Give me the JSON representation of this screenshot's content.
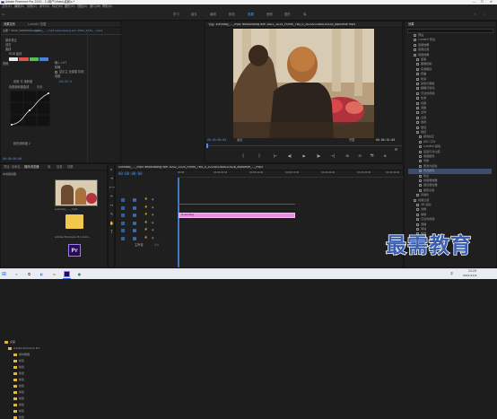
{
  "window": {
    "title": "Adobe Premiere Pro 2020 - C:\\用户\\Video\\桌面\\s *",
    "min": "—",
    "max": "☐",
    "close": "✕"
  },
  "menu": [
    "文件(F)",
    "编辑(E)",
    "剪辑(C)",
    "序列(S)",
    "标记(M)",
    "图形(G)",
    "视图(V)",
    "窗口(W)",
    "帮助(H)"
  ],
  "workspaces": [
    "学习",
    "组件",
    "编辑",
    "颜色",
    "效果",
    "音频",
    "图形",
    "库"
  ],
  "effect_controls": {
    "tabs": [
      "效果控件",
      "Lumetri 范围"
    ],
    "source_clip": "主要 * 2020_9000000...mp4",
    "sequence_clip": "sunnday_..._mp4 lessouwang wm 2002_2024_...mp4",
    "sections": [
      "基本校正",
      "创意",
      "曲线",
      "RGB 曲线",
      "色相饱和度曲线"
    ],
    "rows": {
      "fx": "视频",
      "lut": "输入 LUT",
      "sub": "精确",
      "check_label": "显示主 全部模 特效",
      "bg": "强度",
      "hue_row": "色相 与 饱和度",
      "hue_val": "100.00 %",
      "hue_sel": "色相",
      "bottom": "颜色饱和度 2"
    },
    "timecode": "00:00:00:00"
  },
  "program": {
    "tab": "节目: sunnday_..._mp4 lessouwang wm 2002_2024_Hunts_760_0_20200326002042p_aqd0e0e mp4",
    "timecode_left": "00:00:00:00",
    "fit": "适合",
    "quality": "完整",
    "timecode_right": "00:00:10:00",
    "controls": [
      "{",
      "}",
      "|←",
      "◀|",
      "▶",
      "|▶",
      "→|",
      "⊞",
      "⊟",
      "📷",
      "⊕"
    ]
  },
  "project": {
    "tabs": [
      "项目: 未命名",
      "媒体浏览器",
      "库",
      "信息",
      "效果"
    ],
    "root": "本地驱动器",
    "tree": [
      "桌面",
      "Adobe Premiere Pro",
      "素材教程",
      "新建",
      "新建",
      "新建",
      "新建",
      "新建",
      "新建",
      "新建",
      "新建",
      "新建",
      "新建"
    ],
    "thumb_label": "sunnday_..._mp4",
    "thumb2_label": "Adobe Premiere Pro Auto..."
  },
  "timeline": {
    "tab": "sunnday_..._mp4 lessouwang wm 2002_2024_Hunts_760_0_20200326002042p_aqd0e0e_..._mp4",
    "timecode": "00:00:00:00",
    "ruler": [
      "00:00",
      "00:00:05:00",
      "00:00:10:00",
      "00:00:15:00",
      "00:00:20:00",
      "00:00:25:00",
      "00:00:30:00"
    ],
    "tracks": [
      "V3",
      "V2",
      "V1",
      "A1",
      "A2",
      "A3"
    ],
    "master": "主声道",
    "master_val": "0.0",
    "clip_label": "fx sunnday"
  },
  "effects_panel": {
    "header": "效果",
    "items": [
      "预设",
      "Lumetri 预设",
      "音频效果",
      "音频过渡",
      "视频效果",
      "变换",
      "图像控制",
      "实用程序",
      "扭曲",
      "时间",
      "杂色与颗粒",
      "模糊与锐化",
      "沉浸式视频",
      "生成",
      "视频",
      "调整",
      "过时",
      "过渡",
      "透视",
      "通道",
      "键控",
      "颜色校正",
      "ASC CDL",
      "Lumetri 颜色",
      "亮度与对比度",
      "保留颜色",
      "均衡",
      "更改为颜色",
      "更改颜色",
      "色彩",
      "视频限幅器",
      "通道混合器",
      "颜色平衡",
      "风格化",
      "视频过渡",
      "3D 运动",
      "划像",
      "擦除",
      "沉浸式视频",
      "溶解",
      "滑动",
      "缩放"
    ],
    "highlight": "更改颜色"
  },
  "watermark": "最需教育",
  "taskbar": {
    "search": "⌕",
    "time": "11:23",
    "date": "2021/11/9",
    "lang": "中"
  }
}
